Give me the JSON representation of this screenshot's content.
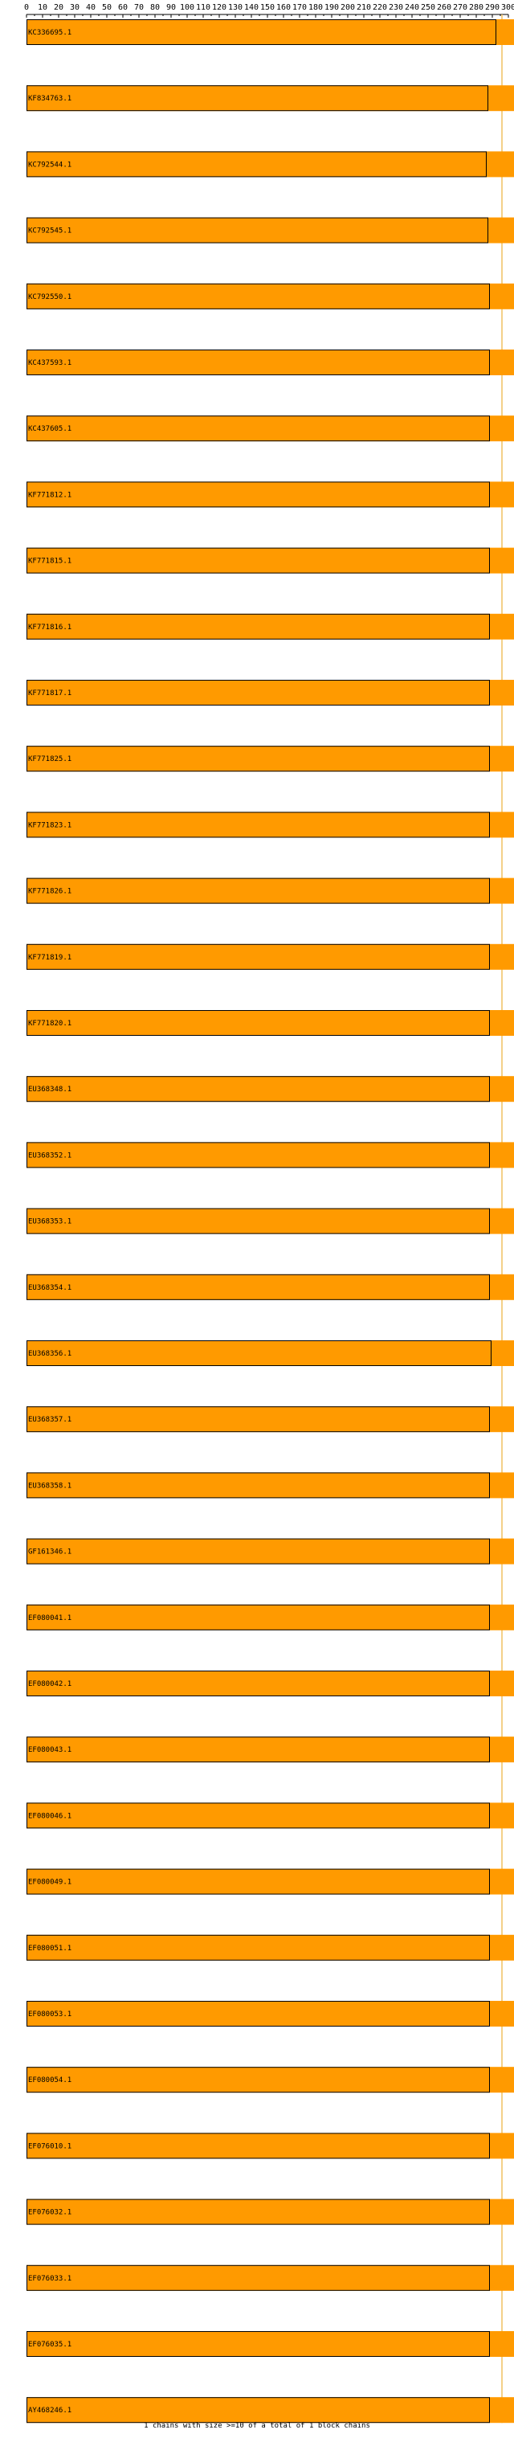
{
  "chart_data": {
    "type": "bar",
    "orientation": "horizontal",
    "xlim": [
      0,
      300
    ],
    "x_ticks": [
      0,
      10,
      20,
      30,
      40,
      50,
      60,
      70,
      80,
      90,
      100,
      110,
      120,
      130,
      140,
      150,
      160,
      170,
      180,
      190,
      200,
      210,
      220,
      230,
      240,
      250,
      260,
      270,
      280,
      290,
      300
    ],
    "grid": false,
    "colors": {
      "bar_fill": "#ff9a00",
      "bar_stroke": "#000000",
      "reference_line": "#f0c060",
      "axis": "#000000"
    },
    "categories": [
      "KC336695.1",
      "KF834763.1",
      "KC792544.1",
      "KC792545.1",
      "KC792550.1",
      "KC437593.1",
      "KC437605.1",
      "KF771812.1",
      "KF771815.1",
      "KF771816.1",
      "KF771817.1",
      "KF771825.1",
      "KF771823.1",
      "KF771826.1",
      "KF771819.1",
      "KF771820.1",
      "EU368348.1",
      "EU368352.1",
      "EU368353.1",
      "EU368354.1",
      "EU368356.1",
      "EU368357.1",
      "EU368358.1",
      "GF161346.1",
      "EF080041.1",
      "EF080042.1",
      "EF080043.1",
      "EF080046.1",
      "EF080049.1",
      "EF080051.1",
      "EF080053.1",
      "EF080054.1",
      "EF076010.1",
      "EF076032.1",
      "EF076033.1",
      "EF076035.1",
      "AY468246.1"
    ],
    "values": [
      292,
      287,
      286,
      287,
      288,
      288,
      288,
      288,
      288,
      288,
      288,
      288,
      288,
      288,
      288,
      288,
      288,
      288,
      288,
      288,
      289,
      288,
      288,
      288,
      288,
      288,
      288,
      288,
      288,
      288,
      288,
      288,
      288,
      288,
      288,
      288,
      288
    ],
    "footer": "1 chains with size >=10 of a total of 1 block chains"
  }
}
